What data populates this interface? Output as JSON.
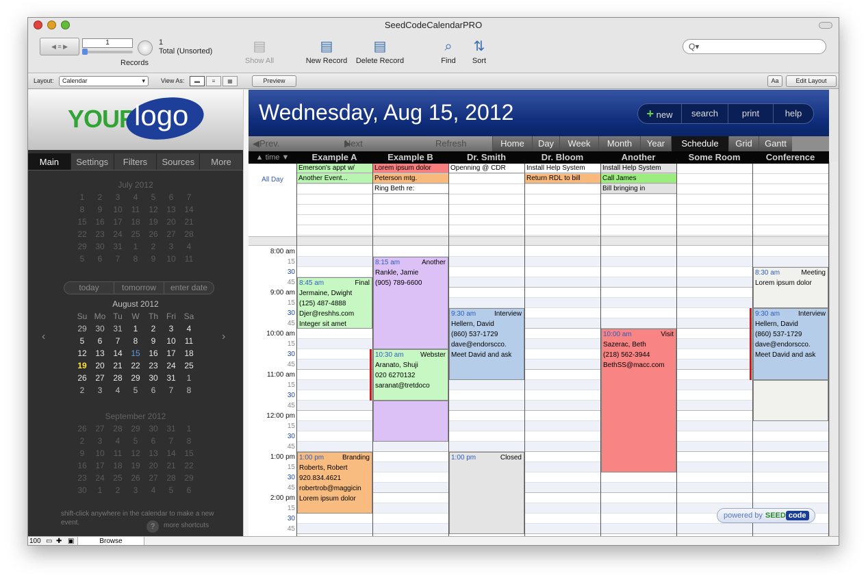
{
  "window": {
    "title": "SeedCodeCalendarPRO"
  },
  "toolbar": {
    "record_value": "1",
    "record_count": "1",
    "record_total": "Total (Unsorted)",
    "records_label": "Records",
    "show_all": "Show All",
    "new_record": "New Record",
    "delete_record": "Delete Record",
    "find": "Find",
    "sort": "Sort",
    "search_placeholder": "Q▾"
  },
  "layoutbar": {
    "layout_label": "Layout:",
    "layout_value": "Calendar",
    "view_as": "View As:",
    "preview": "Preview",
    "aa": "Aa",
    "edit_layout": "Edit Layout"
  },
  "sidebar": {
    "logo_your": "YOUR",
    "logo_logo": "logo",
    "tabs": [
      "Main",
      "Settings",
      "Filters",
      "Sources",
      "More"
    ],
    "months": [
      {
        "title": "July 2012",
        "rows": [
          [
            "1",
            "2",
            "3",
            "4",
            "5",
            "6",
            "7"
          ],
          [
            "8",
            "9",
            "10",
            "11",
            "12",
            "13",
            "14"
          ],
          [
            "15",
            "16",
            "17",
            "18",
            "19",
            "20",
            "21"
          ],
          [
            "22",
            "23",
            "24",
            "25",
            "26",
            "27",
            "28"
          ],
          [
            "29",
            "30",
            "31",
            "1",
            "2",
            "3",
            "4"
          ],
          [
            "5",
            "6",
            "7",
            "8",
            "9",
            "10",
            "11"
          ]
        ]
      },
      {
        "title": "August 2012",
        "rows": [
          [
            "Su",
            "Mo",
            "Tu",
            "W",
            "Th",
            "Fri",
            "Sa"
          ],
          [
            "29",
            "30",
            "31",
            "1",
            "2",
            "3",
            "4"
          ],
          [
            "5",
            "6",
            "7",
            "8",
            "9",
            "10",
            "11"
          ],
          [
            "12",
            "13",
            "14",
            "15",
            "16",
            "17",
            "18"
          ],
          [
            "19",
            "20",
            "21",
            "22",
            "23",
            "24",
            "25"
          ],
          [
            "26",
            "27",
            "28",
            "29",
            "30",
            "31",
            "1"
          ],
          [
            "2",
            "3",
            "4",
            "5",
            "6",
            "7",
            "8"
          ]
        ]
      },
      {
        "title": "September 2012",
        "rows": [
          [
            "26",
            "27",
            "28",
            "29",
            "30",
            "31",
            "1"
          ],
          [
            "2",
            "3",
            "4",
            "5",
            "6",
            "7",
            "8"
          ],
          [
            "9",
            "10",
            "11",
            "12",
            "13",
            "14",
            "15"
          ],
          [
            "16",
            "17",
            "18",
            "19",
            "20",
            "21",
            "22"
          ],
          [
            "23",
            "24",
            "25",
            "26",
            "27",
            "28",
            "29"
          ],
          [
            "30",
            "1",
            "2",
            "3",
            "4",
            "5",
            "6"
          ]
        ]
      }
    ],
    "quick": [
      "today",
      "tomorrow",
      "enter date"
    ],
    "hint": "shift-click anywhere in the calendar to make a new event.",
    "shortcuts": "more shortcuts",
    "help_glyph": "?"
  },
  "calendar": {
    "date_title": "Wednesday, Aug 15, 2012",
    "buttons": [
      "new",
      "search",
      "print",
      "help"
    ],
    "prev_resources": "Prev. Resources",
    "next_resources": "Next Resources",
    "refresh": "Refresh",
    "views": [
      "Home",
      "Day",
      "Week",
      "Month",
      "Year",
      "Schedule",
      "Grid",
      "Gantt"
    ],
    "active_view": "Schedule",
    "time_header": "time",
    "columns": [
      "Example A",
      "Example B",
      "Dr. Smith",
      "Dr. Bloom",
      "Another",
      "Some Room",
      "Conference"
    ],
    "all_day_label": "All Day",
    "all_day_events": [
      {
        "col": 0,
        "row": 0,
        "text": "Emerson's appt w/",
        "color": "#b8f5b0"
      },
      {
        "col": 0,
        "row": 1,
        "text": "Another Event...",
        "color": "#b8f5b0"
      },
      {
        "col": 1,
        "row": 0,
        "text": "Lorem ipsum dolor",
        "color": "#f97f7f"
      },
      {
        "col": 1,
        "row": 1,
        "text": "Peterson mtg.",
        "color": "#f9b97b"
      },
      {
        "col": 1,
        "row": 2,
        "text": "Ring Beth re:",
        "color": "#ffffff"
      },
      {
        "col": 2,
        "row": 0,
        "text": "Openning @ CDR",
        "color": "#ffffff"
      },
      {
        "col": 3,
        "row": 0,
        "text": "Install Help System",
        "color": "#ffffff"
      },
      {
        "col": 3,
        "row": 1,
        "text": "Return RDL to bill",
        "color": "#f9b97b"
      },
      {
        "col": 4,
        "row": 0,
        "text": "Install Help System",
        "color": "#e3e3e3"
      },
      {
        "col": 4,
        "row": 1,
        "text": "Call James",
        "color": "#9bee7d"
      },
      {
        "col": 4,
        "row": 2,
        "text": "Bill bringing in",
        "color": "#e3e3e3"
      }
    ],
    "time_labels": [
      "8:00 am",
      "15",
      "30",
      "45",
      "9:00 am",
      "15",
      "30",
      "45",
      "10:00 am",
      "15",
      "30",
      "45",
      "11:00 am",
      "15",
      "30",
      "45",
      "12:00 pm",
      "15",
      "30",
      "45",
      "1:00 pm",
      "15",
      "30",
      "45",
      "2:00 pm",
      "15",
      "30",
      "45"
    ],
    "events": [
      {
        "col": 1,
        "start": 1,
        "slots": 9,
        "time": "8:15 am",
        "title": "Another",
        "lines": [
          "Rankle, Jamie",
          "(905) 789-6600"
        ],
        "color": "#dbc1f5"
      },
      {
        "col": 1,
        "start": 10,
        "slots": 5,
        "time": "10:30 am",
        "title": "Webster",
        "lines": [
          "Aranato, Shuji",
          "020 6270132",
          "saranat@tretdoco"
        ],
        "color": "#c7f7c2",
        "bar": true
      },
      {
        "col": 1,
        "start": 15,
        "slots": 4,
        "time": "",
        "title": "",
        "lines": [],
        "color": "#dbc1f5"
      },
      {
        "col": 0,
        "start": 3,
        "slots": 5,
        "time": "8:45 am",
        "title": "Final",
        "lines": [
          "Jermaine, Dwight",
          "(125) 487-4888",
          "Djer@reshhs.com",
          "Integer sit amet"
        ],
        "color": "#c7f7c2"
      },
      {
        "col": 2,
        "start": 6,
        "slots": 7,
        "time": "9:30 am",
        "title": "Interview",
        "lines": [
          "Hellern, David",
          "(860) 537-1729",
          "dave@endorscco.",
          "Meet David and ask"
        ],
        "color": "#b5cde8"
      },
      {
        "col": 4,
        "start": 8,
        "slots": 14,
        "time": "10:00 am",
        "title": "Visit",
        "lines": [
          "Sazerac, Beth",
          "(218) 562-3944",
          "BethSS@macc.com"
        ],
        "color": "#f98484"
      },
      {
        "col": 6,
        "start": 2,
        "slots": 4,
        "time": "8:30 am",
        "title": "Meeting",
        "lines": [
          "Lorem ipsum dolor"
        ],
        "color": "#f1f1ee"
      },
      {
        "col": 6,
        "start": 6,
        "slots": 7,
        "time": "9:30 am",
        "title": "Interview",
        "lines": [
          "Hellern, David",
          "(860) 537-1729",
          "dave@endorscco.",
          "Meet David and ask"
        ],
        "color": "#b5cde8",
        "bar": true
      },
      {
        "col": 6,
        "start": 13,
        "slots": 4,
        "time": "",
        "title": "",
        "lines": [],
        "color": "#f1f1ee"
      },
      {
        "col": 0,
        "start": 20,
        "slots": 6,
        "time": "1:00 pm",
        "title": "Branding",
        "lines": [
          "Roberts, Robert",
          "920.834.4621",
          "robertrob@maggicin",
          "Lorem ipsum dolor"
        ],
        "color": "#f9bc80"
      },
      {
        "col": 2,
        "start": 20,
        "slots": 8,
        "time": "1:00 pm",
        "title": "Closed",
        "lines": [],
        "color": "#e4e4e4"
      }
    ],
    "powered_by": "powered by",
    "seed": "SEED",
    "code": "code"
  },
  "statusbar": {
    "zoom": "100",
    "mode": "Browse"
  }
}
